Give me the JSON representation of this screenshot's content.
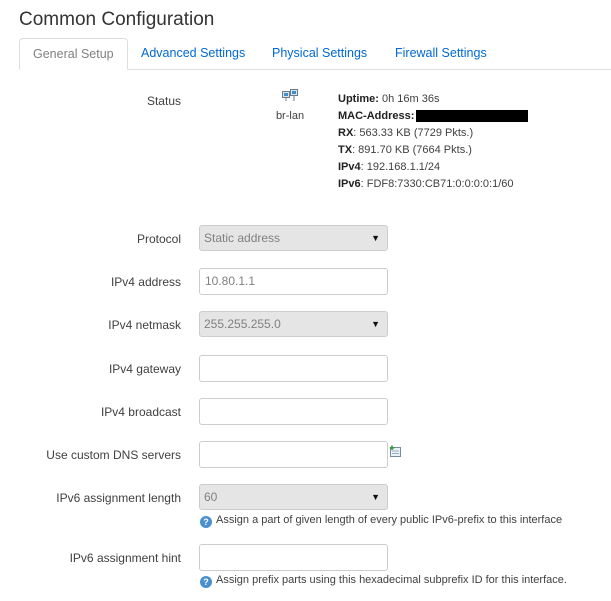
{
  "page": {
    "title": "Common Configuration"
  },
  "tabs": [
    {
      "label": "General Setup",
      "active": true
    },
    {
      "label": "Advanced Settings",
      "active": false
    },
    {
      "label": "Physical Settings",
      "active": false
    },
    {
      "label": "Firewall Settings",
      "active": false
    }
  ],
  "status": {
    "label": "Status",
    "interface_icon": "network-interface-icon",
    "interface_name": "br-lan",
    "uptime_label": "Uptime:",
    "uptime_value": "0h 16m 36s",
    "mac_label": "MAC-Address:",
    "rx_label": "RX",
    "rx_value": ": 563.33 KB (7729 Pkts.)",
    "tx_label": "TX",
    "tx_value": ": 891.70 KB (7664 Pkts.)",
    "ipv4_label": "IPv4",
    "ipv4_value": ": 192.168.1.1/24",
    "ipv6_label": "IPv6",
    "ipv6_value": ": FDF8:7330:CB71:0:0:0:0:1/60"
  },
  "form": {
    "protocol": {
      "label": "Protocol",
      "value": "Static address"
    },
    "ipv4_address": {
      "label": "IPv4 address",
      "value": "10.80.1.1"
    },
    "ipv4_netmask": {
      "label": "IPv4 netmask",
      "value": "255.255.255.0"
    },
    "ipv4_gateway": {
      "label": "IPv4 gateway",
      "value": ""
    },
    "ipv4_broadcast": {
      "label": "IPv4 broadcast",
      "value": ""
    },
    "dns_servers": {
      "label": "Use custom DNS servers",
      "value": ""
    },
    "ipv6_assignment_length": {
      "label": "IPv6 assignment length",
      "value": "60",
      "help": "Assign a part of given length of every public IPv6-prefix to this interface"
    },
    "ipv6_assignment_hint": {
      "label": "IPv6 assignment hint",
      "value": "",
      "help": "Assign prefix parts using this hexadecimal subprefix ID for this interface."
    }
  },
  "colors": {
    "link": "#0069d6",
    "help_icon": "#4a8fd0",
    "disabled_field": "#e5e5e5"
  }
}
